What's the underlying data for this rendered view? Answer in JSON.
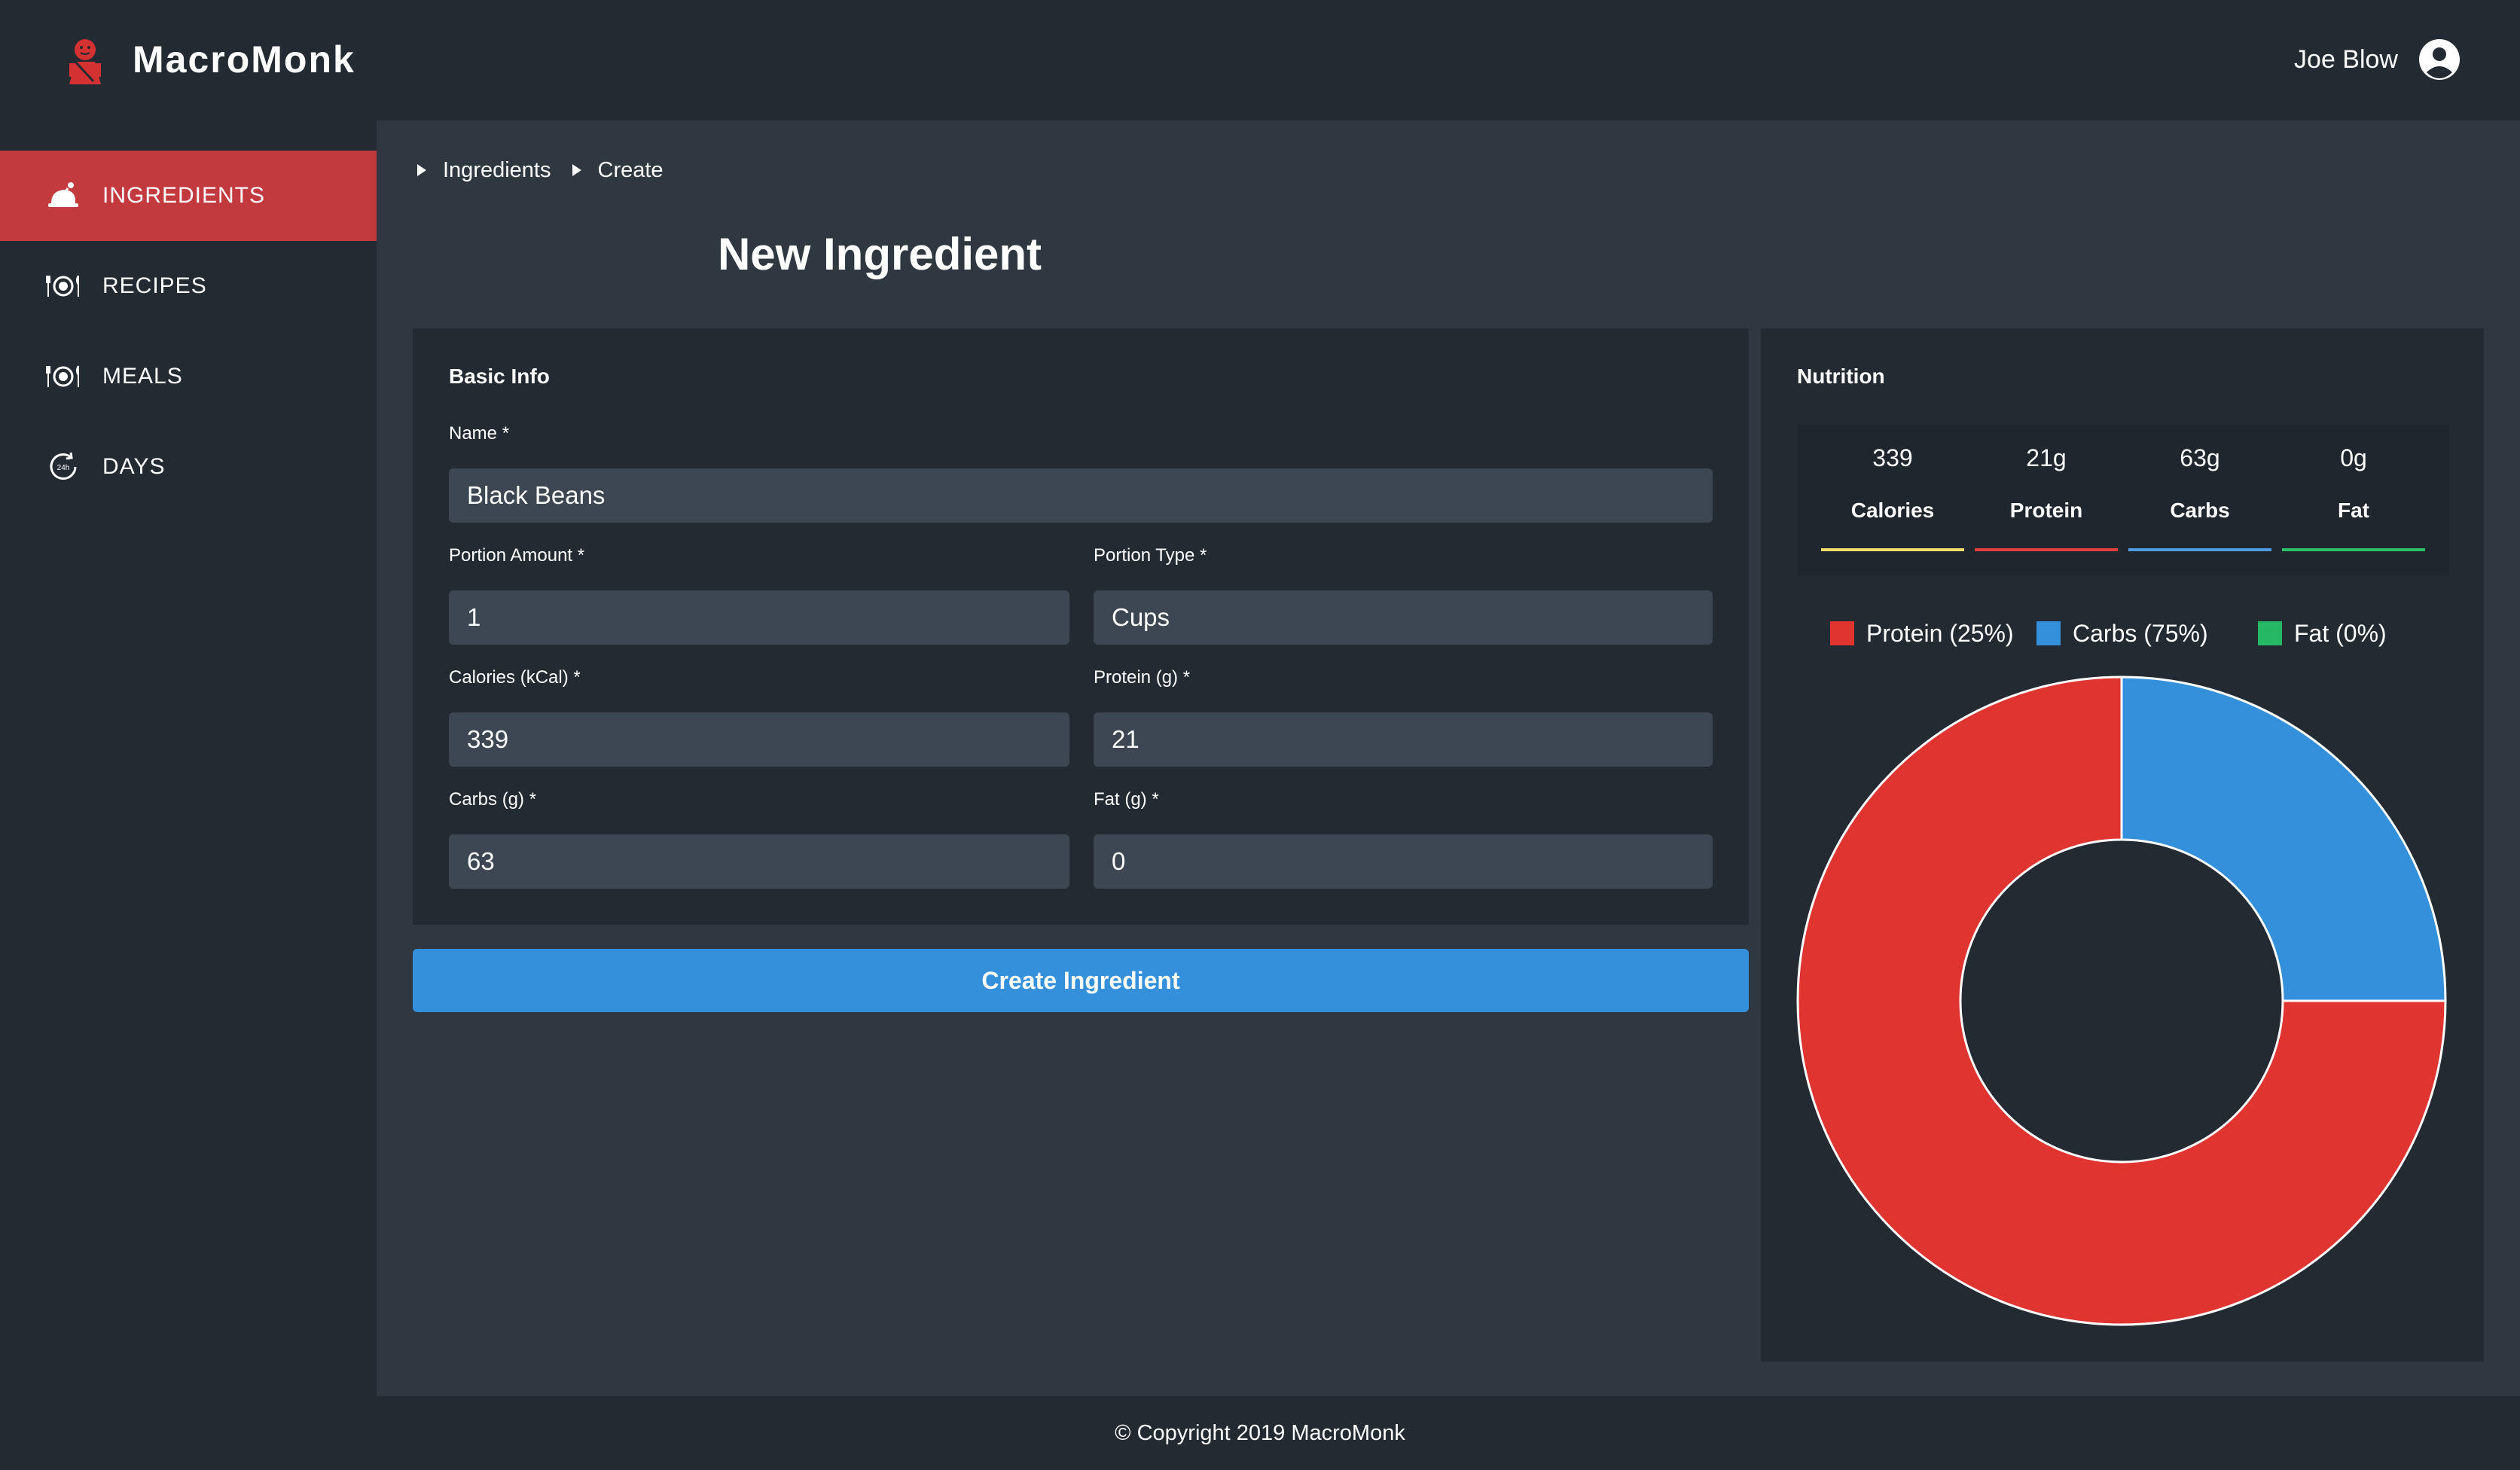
{
  "app": {
    "name": "MacroMonk"
  },
  "user": {
    "name": "Joe Blow",
    "icon": "user-circle-icon"
  },
  "sidebar": {
    "items": [
      {
        "label": "INGREDIENTS",
        "icon": "chicken-icon",
        "active": true
      },
      {
        "label": "RECIPES",
        "icon": "plate-cutlery-icon",
        "active": false
      },
      {
        "label": "MEALS",
        "icon": "plate-cutlery-icon",
        "active": false
      },
      {
        "label": "DAYS",
        "icon": "24h-clock-icon",
        "active": false
      }
    ]
  },
  "breadcrumb": [
    "Ingredients",
    "Create"
  ],
  "page_title": "New Ingredient",
  "basic_info": {
    "title": "Basic Info",
    "name": {
      "label": "Name *",
      "value": "Black Beans"
    },
    "portion_amount": {
      "label": "Portion Amount *",
      "value": "1"
    },
    "portion_type": {
      "label": "Portion Type *",
      "value": "Cups"
    },
    "calories": {
      "label": "Calories (kCal) *",
      "value": "339"
    },
    "protein": {
      "label": "Protein (g) *",
      "value": "21"
    },
    "carbs": {
      "label": "Carbs (g) *",
      "value": "63"
    },
    "fat": {
      "label": "Fat (g) *",
      "value": "0"
    }
  },
  "create_button": "Create Ingredient",
  "nutrition": {
    "title": "Nutrition",
    "stats": [
      {
        "value": "339",
        "label": "Calories",
        "color": "#f2dd6b"
      },
      {
        "value": "21g",
        "label": "Protein",
        "color": "#e0413d"
      },
      {
        "value": "63g",
        "label": "Carbs",
        "color": "#4d9be0"
      },
      {
        "value": "0g",
        "label": "Fat",
        "color": "#2dbf6a"
      }
    ]
  },
  "chart_data": {
    "type": "pie",
    "variant": "donut",
    "categories": [
      "Protein (25%)",
      "Carbs (75%)",
      "Fat (0%)"
    ],
    "values": [
      75,
      25,
      0
    ],
    "colors": [
      "#e03430",
      "#3590dc",
      "#26b864"
    ],
    "legend_position": "top"
  },
  "footer": "© Copyright 2019 MacroMonk"
}
